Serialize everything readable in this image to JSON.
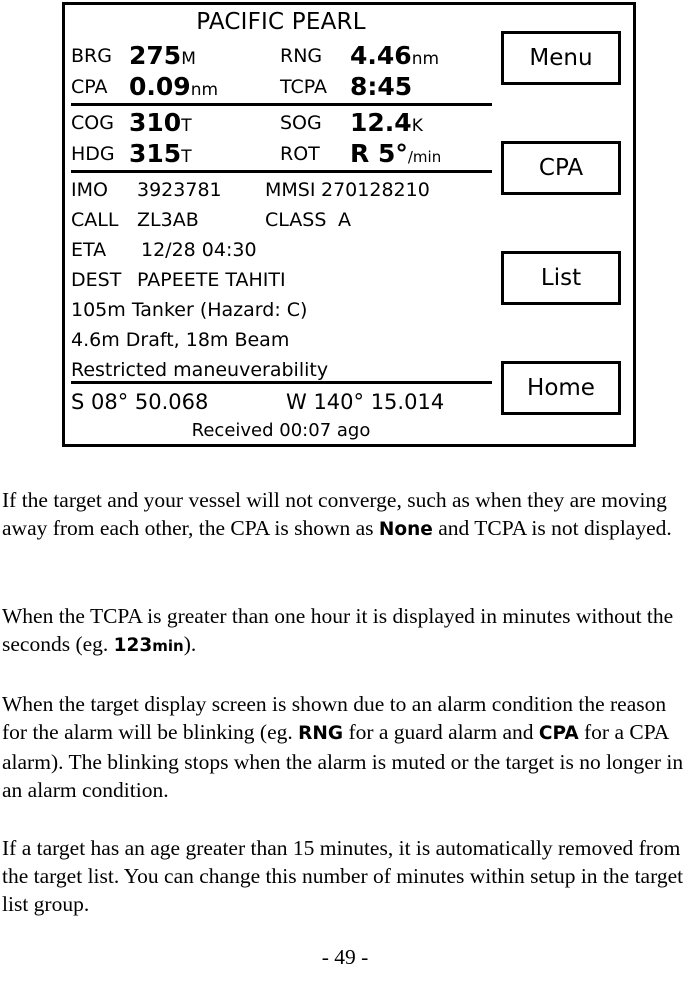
{
  "device": {
    "title": "PACIFIC PEARL",
    "nav_rows": [
      {
        "left_label": "BRG",
        "left_value": "275",
        "left_unit": "M",
        "right_label": "RNG",
        "right_value": "4.46",
        "right_unit": "nm"
      },
      {
        "left_label": "CPA",
        "left_value": "0.09",
        "left_unit": "nm",
        "right_label": "TCPA",
        "right_value": "8:45",
        "right_unit": ""
      },
      {
        "left_label": "COG",
        "left_value": "310",
        "left_unit": "T",
        "right_label": "SOG",
        "right_value": "12.4",
        "right_unit": "K"
      },
      {
        "left_label": "HDG",
        "left_value": "315",
        "left_unit": "T",
        "right_label": "ROT",
        "right_value": "R 5°",
        "right_unit": "/min"
      }
    ],
    "static_rows": [
      {
        "left_label": "IMO",
        "left_value": "3923781",
        "right_label": "MMSI",
        "right_value": "270128210"
      },
      {
        "left_label": "CALL",
        "left_value": "ZL3AB",
        "right_label": "CLASS",
        "right_value": "A"
      }
    ],
    "eta_label": "ETA",
    "eta_value": "12/28 04:30",
    "dest_label": "DEST",
    "dest_value": "PAPEETE TAHITI",
    "dimensions_line": "105m Tanker (Hazard: C)",
    "draft_line": "4.6m Draft, 18m Beam",
    "status_line": "Restricted maneuverability",
    "latitude": "S 08° 50.068",
    "longitude": "W 140° 15.014",
    "received": "Received 00:07 ago",
    "softkeys": [
      {
        "label": "Menu"
      },
      {
        "label": "CPA"
      },
      {
        "label": "List"
      },
      {
        "label": "Home"
      }
    ]
  },
  "body": {
    "paragraphs": [
      {
        "parts": [
          {
            "text": "If the target and your vessel will not converge, such as when they are moving away from each other, the CPA is shown as ",
            "style": "normal"
          },
          {
            "text": "None",
            "style": "ui"
          },
          {
            "text": " and TCPA is not displayed.",
            "style": "normal"
          }
        ]
      },
      {
        "parts": [
          {
            "text": "When the TCPA is greater than one hour it is displayed in minutes without the seconds (eg. ",
            "style": "normal"
          },
          {
            "text": "123",
            "style": "ui",
            "suffix": "min"
          },
          {
            "text": ").",
            "style": "normal"
          }
        ]
      },
      {
        "parts": [
          {
            "text": "When the target display screen is shown due to an alarm condition the reason for the alarm will be blinking (eg. ",
            "style": "normal"
          },
          {
            "text": "RNG",
            "style": "ui"
          },
          {
            "text": " for a guard alarm and ",
            "style": "normal"
          },
          {
            "text": "CPA",
            "style": "ui"
          },
          {
            "text": " for a CPA alarm). The blinking stops when the alarm is muted or the target is no longer in an alarm condition.",
            "style": "normal"
          }
        ]
      },
      {
        "parts": [
          {
            "text": "If a target has an age greater than 15 minutes, it is automatically removed from the target list. You can change this number of minutes within setup in the target list group.",
            "style": "normal"
          }
        ]
      }
    ]
  },
  "footer": {
    "page_number": "- 49 -"
  }
}
